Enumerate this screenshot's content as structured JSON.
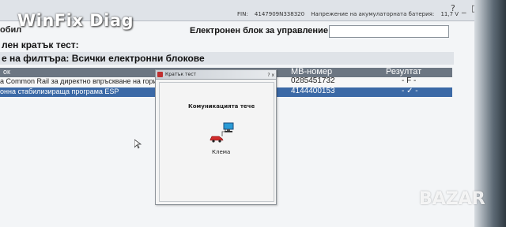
{
  "brand": "WinFix Diag",
  "status_bar": {
    "fin_label": "FIN:",
    "fin_value": "4147909N338320",
    "voltage_label": "Напрежение на акумулаторната батерия:",
    "voltage_value": "11,7 V"
  },
  "window_controls": [
    "?",
    "_",
    "□"
  ],
  "ecu_row": {
    "left_label": "обил",
    "title": "Електронен блок за управление",
    "input_value": ""
  },
  "short_test_label": "лен кратък тест:",
  "filter_label": "е на филтъра: Всички електронни блокове",
  "table": {
    "headers": {
      "name": "ок",
      "mb_number": "МВ-номер",
      "result": "Резултат"
    },
    "rows": [
      {
        "name": "a Common Rail за директно впръскване на гори",
        "mb_number": "0285451732",
        "result": "- F -",
        "selected": false
      },
      {
        "name": "онна стабилизираща програма ESP",
        "mb_number": "4144400153",
        "result": "- ✓ -",
        "selected": true
      }
    ]
  },
  "dialog": {
    "title": "Кратък тест",
    "buttons": [
      "?",
      "x"
    ],
    "communication_label": "Комуникацията тече",
    "status_label": "Клема"
  },
  "watermark": "BAZAR",
  "colors": {
    "selection": "#3b69a6",
    "table_header": "#6c7682",
    "background": "#f3f5f7"
  }
}
